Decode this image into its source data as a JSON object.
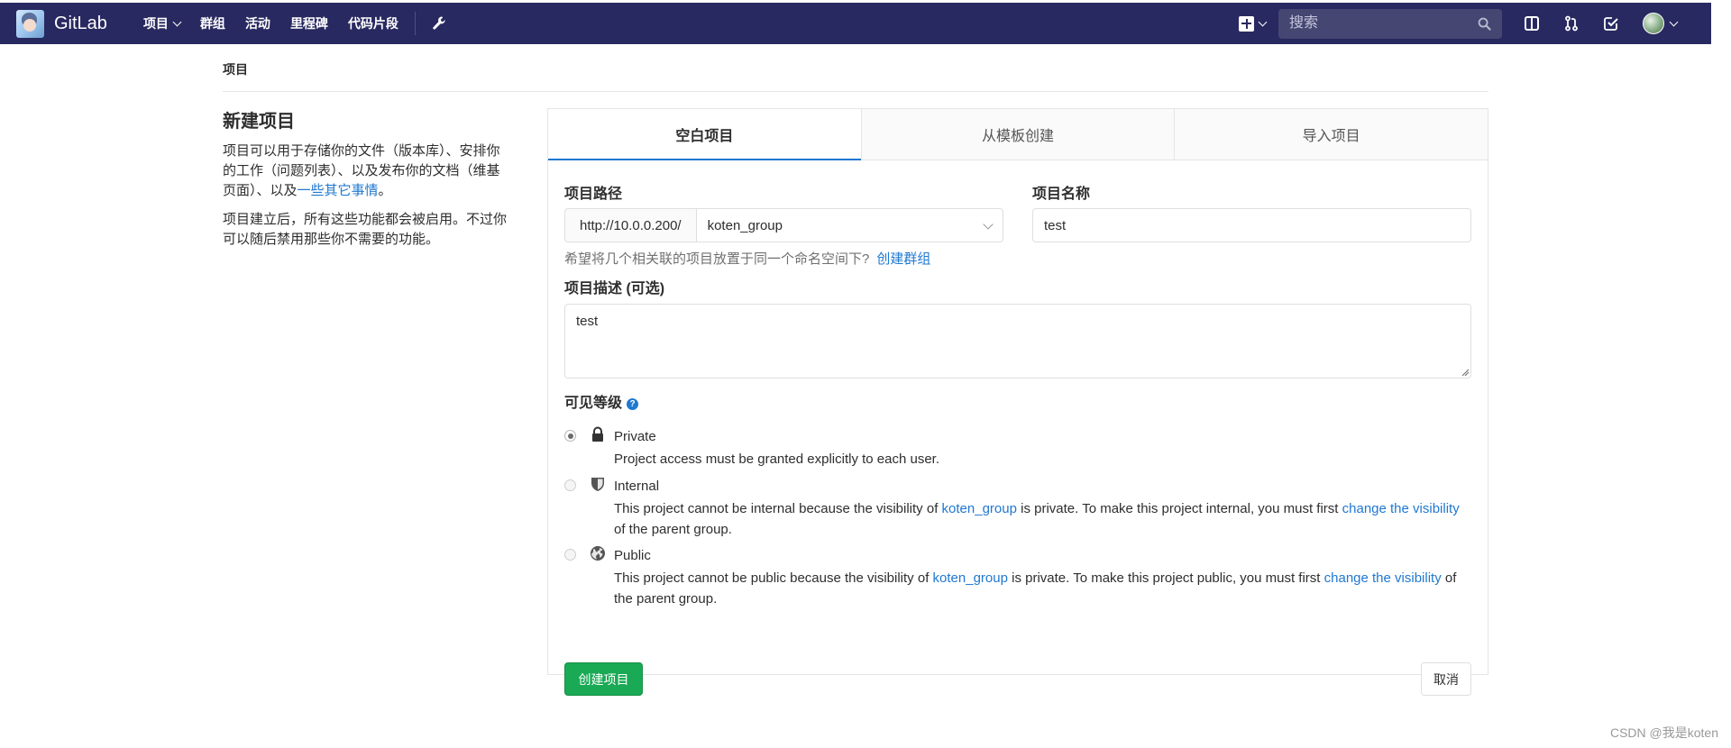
{
  "navbar": {
    "brand": "GitLab",
    "menu": [
      "项目",
      "群组",
      "活动",
      "里程碑",
      "代码片段"
    ],
    "search_placeholder": "搜索",
    "icons": [
      "plus-square-icon",
      "sidebar-icon",
      "merge-request-icon",
      "todo-check-icon",
      "wrench-icon",
      "search-icon"
    ]
  },
  "breadcrumb": "项目",
  "intro": {
    "title": "新建项目",
    "paragraph1": "项目可以用于存储你的文件（版本库）、安排你的工作（问题列表）、以及发布你的文档（维基页面）、以及",
    "paragraph1_link": "一些其它事情",
    "paragraph1_end": "。",
    "paragraph2": "项目建立后，所有这些功能都会被启用。不过你可以随后禁用那些你不需要的功能。"
  },
  "tabs": [
    "空白项目",
    "从模板创建",
    "导入项目"
  ],
  "form": {
    "path_label": "项目路径",
    "path_prefix": "http://10.0.0.200/",
    "namespace": "koten_group",
    "name_label": "项目名称",
    "name_value": "test",
    "namespace_help": "希望将几个相关联的项目放置于同一个命名空间下?",
    "namespace_help_link": "创建群组",
    "description_label": "项目描述 (可选)",
    "description_value": "test",
    "visibility_label": "可见等级",
    "visibility_help_icon": "?",
    "visibility_options": [
      {
        "title": "Private",
        "desc": "Project access must be granted explicitly to each user.",
        "checked": true,
        "icon": "lock-icon"
      },
      {
        "title": "Internal",
        "desc_pre": "This project cannot be internal because the visibility of ",
        "desc_link": "koten_group",
        "desc_mid": " is private. To make this project internal, you must first ",
        "desc_link2": "change the visibility",
        "desc_post": " of the parent group.",
        "checked": false,
        "icon": "shield-icon"
      },
      {
        "title": "Public",
        "desc_pre": "This project cannot be public because the visibility of ",
        "desc_link": "koten_group",
        "desc_mid": " is private. To make this project public, you must first ",
        "desc_link2": "change the visibility",
        "desc_post": " of the parent group.",
        "checked": false,
        "icon": "globe-icon"
      }
    ],
    "create_label": "创建项目",
    "cancel_label": "取消"
  },
  "watermark": "CSDN @我是koten",
  "colors": {
    "navbar": "#292961",
    "link": "#1f78d1",
    "success": "#1aaa55"
  }
}
